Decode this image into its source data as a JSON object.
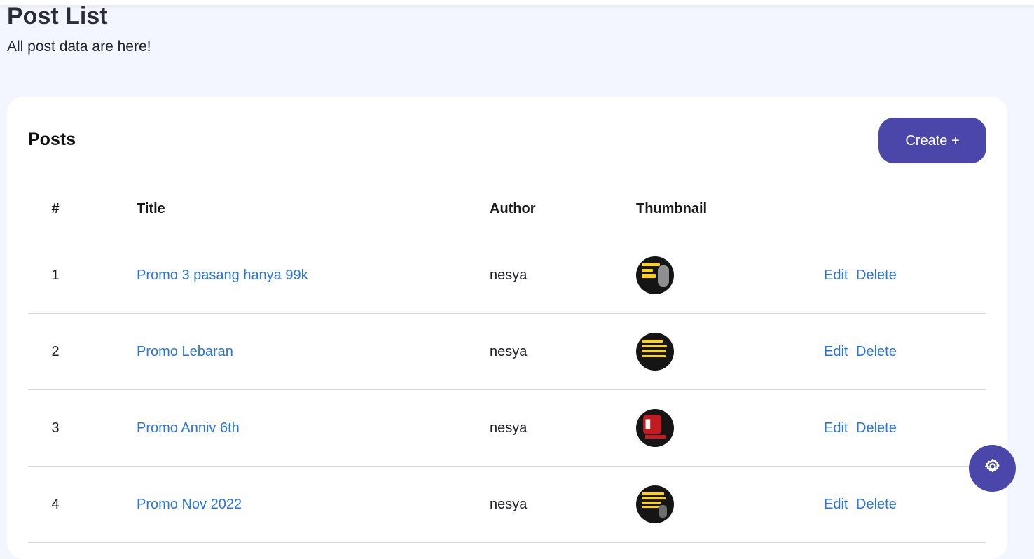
{
  "page": {
    "title": "Post List",
    "subtitle": "All post data are here!"
  },
  "card": {
    "title": "Posts",
    "create_label": "Create +"
  },
  "table": {
    "headers": {
      "number": "#",
      "title": "Title",
      "author": "Author",
      "thumbnail": "Thumbnail"
    },
    "rows": [
      {
        "number": "1",
        "title": "Promo 3 pasang hanya 99k",
        "author": "nesya",
        "edit_label": "Edit",
        "delete_label": "Delete"
      },
      {
        "number": "2",
        "title": "Promo Lebaran",
        "author": "nesya",
        "edit_label": "Edit",
        "delete_label": "Delete"
      },
      {
        "number": "3",
        "title": "Promo Anniv 6th",
        "author": "nesya",
        "edit_label": "Edit",
        "delete_label": "Delete"
      },
      {
        "number": "4",
        "title": "Promo Nov 2022",
        "author": "nesya",
        "edit_label": "Edit",
        "delete_label": "Delete"
      }
    ]
  },
  "theme": {
    "background": "#f3f6fe",
    "primary": "#4b47aa",
    "link": "#2a75dc",
    "divider": "#d5d7dc"
  },
  "icons": {
    "settings": "gear-icon"
  }
}
